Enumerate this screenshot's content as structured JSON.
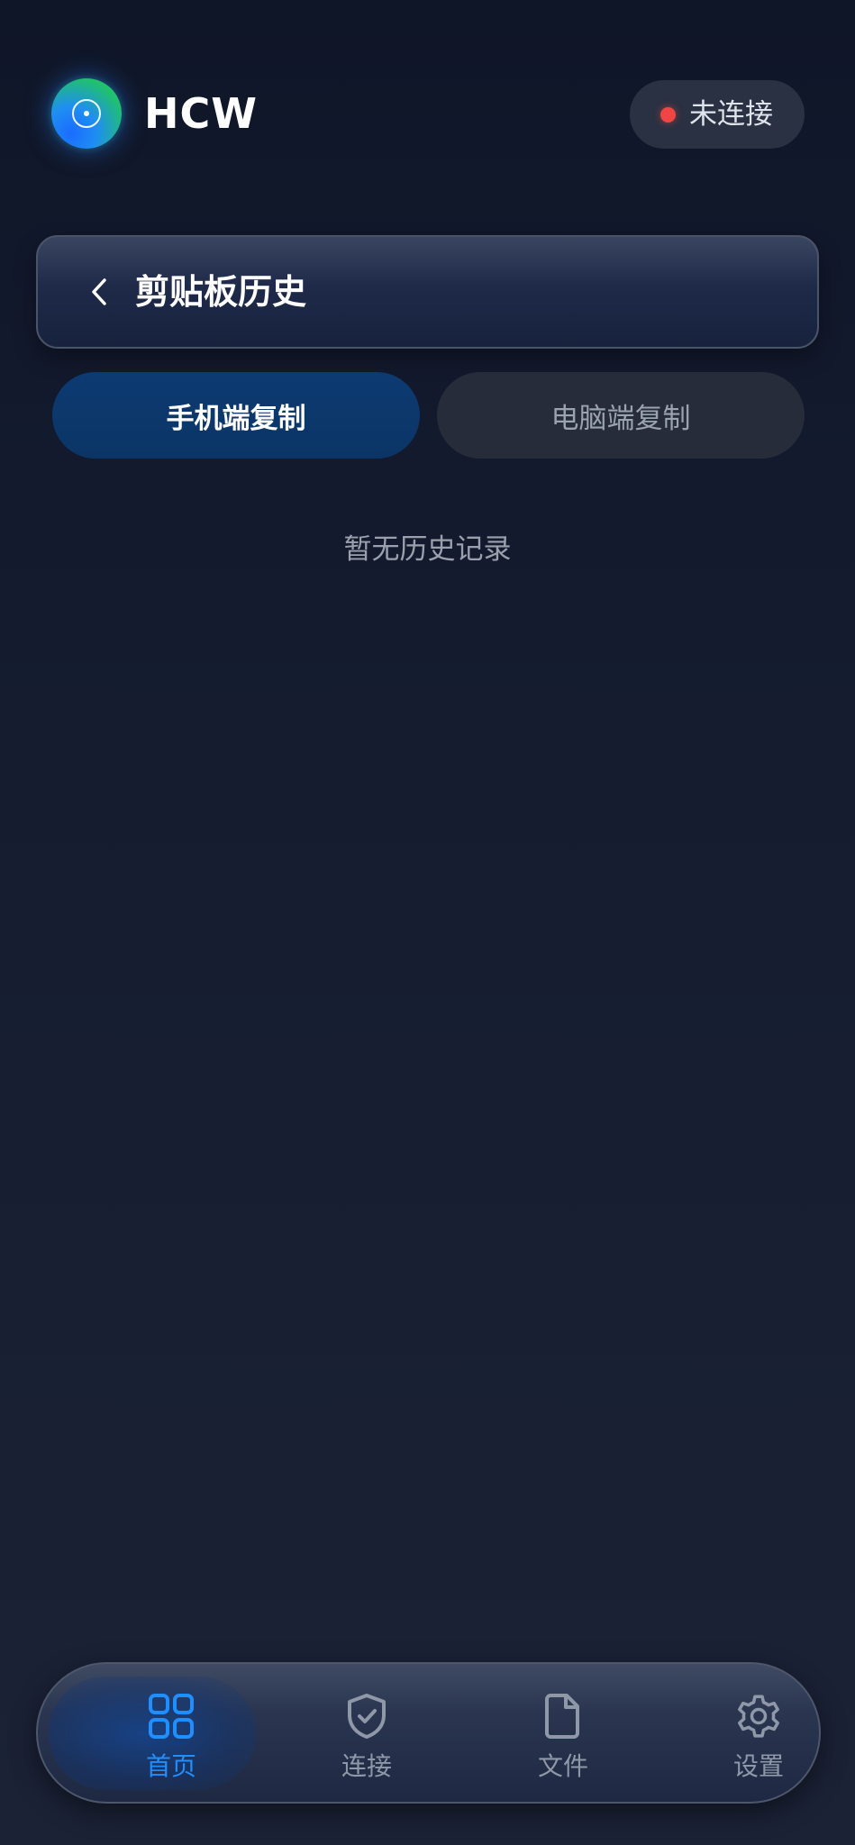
{
  "header": {
    "app_name": "HCW",
    "logo_icon": "app-logo-icon",
    "connection_status": "未连接",
    "status_color": "#f04545"
  },
  "page": {
    "title": "剪贴板历史",
    "back_icon": "chevron-left-icon"
  },
  "tabs": [
    {
      "label": "手机端复制",
      "active": true
    },
    {
      "label": "电脑端复制",
      "active": false
    }
  ],
  "empty_state": {
    "text": "暂无历史记录"
  },
  "bottom_nav": [
    {
      "label": "首页",
      "icon": "grid-icon",
      "active": true
    },
    {
      "label": "连接",
      "icon": "shield-check-icon",
      "active": false
    },
    {
      "label": "文件",
      "icon": "file-icon",
      "active": false
    },
    {
      "label": "设置",
      "icon": "gear-icon",
      "active": false
    }
  ],
  "colors": {
    "accent": "#1f8fff",
    "active_tab": "#0c3a72",
    "inactive_tab": "#262c3a",
    "background": "#151c30"
  }
}
